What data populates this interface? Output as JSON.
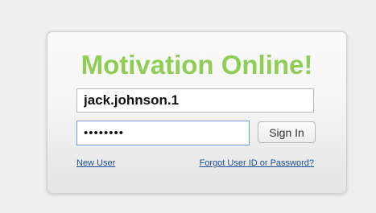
{
  "login": {
    "title": "Motivation Online!",
    "username_value": "jack.johnson.1",
    "password_value": "••••••••",
    "signin_label": "Sign In",
    "new_user_label": "New User",
    "forgot_label": "Forgot User ID or Password?"
  },
  "colors": {
    "title": "#8fcd56",
    "link": "#1a4f9c",
    "focus_border": "#6f9bd6",
    "page_background": "#efefef"
  }
}
